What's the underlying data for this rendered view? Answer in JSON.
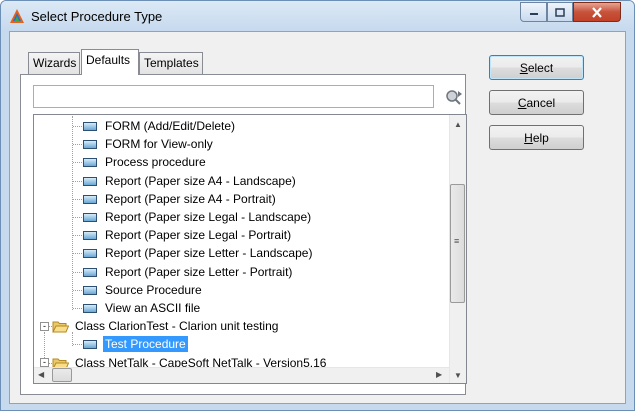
{
  "window": {
    "title": "Select Procedure Type"
  },
  "tabs": [
    {
      "label": "Wizards",
      "active": false
    },
    {
      "label": "Defaults",
      "active": true
    },
    {
      "label": "Templates",
      "active": false
    }
  ],
  "search": {
    "value": ""
  },
  "tree": {
    "items": [
      {
        "label": "FORM (Add/Edit/Delete)",
        "icon": "procedure-icon",
        "level": 1
      },
      {
        "label": "FORM for View-only",
        "icon": "procedure-icon",
        "level": 1
      },
      {
        "label": "Process procedure",
        "icon": "procedure-icon",
        "level": 1
      },
      {
        "label": "Report (Paper size A4 - Landscape)",
        "icon": "procedure-icon",
        "level": 1
      },
      {
        "label": "Report (Paper size A4 - Portrait)",
        "icon": "procedure-icon",
        "level": 1
      },
      {
        "label": "Report (Paper size Legal - Landscape)",
        "icon": "procedure-icon",
        "level": 1
      },
      {
        "label": "Report (Paper size Legal - Portrait)",
        "icon": "procedure-icon",
        "level": 1
      },
      {
        "label": "Report (Paper size Letter - Landscape)",
        "icon": "procedure-icon",
        "level": 1
      },
      {
        "label": "Report (Paper size Letter - Portrait)",
        "icon": "procedure-icon",
        "level": 1
      },
      {
        "label": "Source Procedure",
        "icon": "procedure-icon",
        "level": 1
      },
      {
        "label": "View an ASCII file",
        "icon": "procedure-icon",
        "level": 1
      },
      {
        "label": "Class ClarionTest - Clarion unit testing",
        "icon": "folder-open-icon",
        "level": 0,
        "expander": "-"
      },
      {
        "label": "Test Procedure",
        "icon": "procedure-icon",
        "level": 1,
        "selected": true
      },
      {
        "label": "Class NetTalk - CapeSoft NetTalk - Version5.16",
        "icon": "folder-open-icon",
        "level": 0,
        "expander": "-"
      }
    ]
  },
  "buttons": {
    "select_prefix": "",
    "select_mnemonic": "S",
    "select_rest": "elect",
    "cancel_mnemonic": "C",
    "cancel_rest": "ancel",
    "help_mnemonic": "H",
    "help_rest": "elp"
  },
  "colors": {
    "selection": "#3399ff",
    "frame": "#c7d9ec",
    "close_button": "#c7533b"
  }
}
